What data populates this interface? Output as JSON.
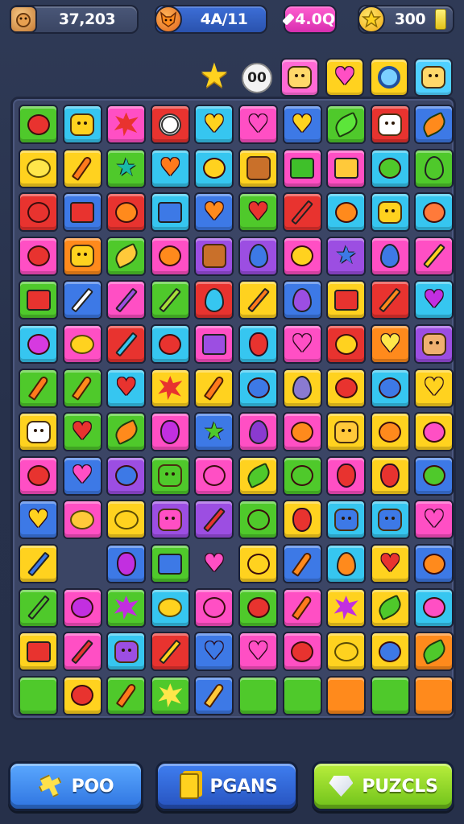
{
  "hud": {
    "coins": {
      "value": "37,203",
      "icon": "coin-icon"
    },
    "lives": {
      "value": "4A/11",
      "icon": "fox-icon"
    },
    "gems": {
      "value": "4.0Q",
      "icon": "gem-icon"
    },
    "stars": {
      "value": "300",
      "icon": "star-icon"
    }
  },
  "goals": {
    "star_icon": "★",
    "moves": "00",
    "targets": [
      {
        "icon": "face-icon",
        "color": "#ff6ad5"
      },
      {
        "icon": "heart-icon",
        "color": "#ffd21f"
      },
      {
        "icon": "ring-icon",
        "color": "#ffd21f"
      },
      {
        "icon": "face-icon",
        "color": "#4fd0ff"
      }
    ]
  },
  "board": {
    "cols": 10,
    "rows": 14,
    "tile_colors": {
      "R": "#e8332f",
      "O": "#ff8a1c",
      "Y": "#ffd21f",
      "G": "#4fc92b",
      "C": "#36c6f0",
      "B": "#3d79e6",
      "P": "#9c4ee2",
      "M": "#ff4fc4",
      "X": "#ffffff"
    },
    "grid": [
      [
        "G:apple:#e8332f",
        "C:face:#ffd21f",
        "M:splat:#e8332f",
        "R:ring:#ffffff",
        "C:heart:#ffd21f",
        "M:heart:#ff4fc4",
        "B:heart:#ffd21f",
        "G:leaf:#5ce53a",
        "R:face:#ffffff",
        "B:leaf:#ff8a1c"
      ],
      [
        "Y:lemon:#ffe64a",
        "Y:carrot:#ff7a1c",
        "G:star:#19b9a8",
        "C:heart:#ff7a1c",
        "C:apple:#ffd21f",
        "Y:waffle:#c9702a",
        "M:box:#3fc02a",
        "M:box:#ffc93a",
        "C:apple:#4fc92b",
        "G:drop:#4fc92b"
      ],
      [
        "R:apple:#e8332f",
        "B:box:#e8332f",
        "R:apple:#ff8a1c",
        "C:box:#3d79e6",
        "B:heart:#ff8a1c",
        "G:heart:#e8332f",
        "R:pencil:#e8332f",
        "C:apple:#ff8a1c",
        "C:face:#ffd21f",
        "C:apple:#ff7a3a"
      ],
      [
        "M:apple:#e8332f",
        "O:face:#ffd21f",
        "G:leaf:#ffc93a",
        "M:apple:#ff8a1c",
        "P:waffle:#c9702a",
        "P:drop:#3d79e6",
        "M:apple:#ffd21f",
        "P:star:#3d79e6",
        "M:drop:#3d79e6",
        "M:pencil:#ffd21f"
      ],
      [
        "G:box:#e8332f",
        "B:pencil:#ffffff",
        "M:pencil:#9c4ee2",
        "G:pencil:#a8e03a",
        "R:drop:#36c6f0",
        "Y:pencil:#ff7a1c",
        "B:drop:#9c4ee2",
        "Y:box:#e8332f",
        "R:pencil:#ff8a1c",
        "C:heart:#c22fe0"
      ],
      [
        "C:apple:#d63ae0",
        "M:lemon:#ffd21f",
        "R:pencil:#36c6f0",
        "C:apple:#e8332f",
        "M:box:#9c4ee2",
        "C:berry:#e8332f",
        "M:heart:#ff4fc4",
        "R:apple:#ffd21f",
        "O:heart:#ffe64a",
        "P:face:#f0b070"
      ],
      [
        "G:carrot:#ff7a1c",
        "G:carrot:#ff8a1c",
        "C:heart:#e8332f",
        "Y:splat:#e8332f",
        "Y:carrot:#ff7a1c",
        "C:apple:#3d79e6",
        "Y:drop:#8a7ad0",
        "Y:apple:#e8332f",
        "C:apple:#3d79e6",
        "Y:heart:#ffd21f"
      ],
      [
        "Y:face:#ffffff",
        "G:heart:#e8332f",
        "G:leaf:#ff8a1c",
        "M:berry:#c22fe0",
        "B:star:#4fc92b",
        "M:drop:#8a3ad0",
        "M:apple:#ff8a1c",
        "Y:face:#ffc93a",
        "Y:apple:#ff8a1c",
        "Y:apple:#ff4fc4"
      ],
      [
        "M:apple:#e8332f",
        "B:heart:#ff4fc4",
        "P:apple:#3d79e6",
        "G:face:#4fc92b",
        "M:apple:#ff4fc4",
        "Y:leaf:#4fc92b",
        "G:apple:#4fc92b",
        "M:berry:#e8332f",
        "Y:berry:#e8332f",
        "B:apple:#4fc92b"
      ],
      [
        "B:heart:#ffd21f",
        "M:lemon:#ffc93a",
        "Y:lemon:#ffd21f",
        "P:face:#ff4fc4",
        "P:pencil:#e8332f",
        "G:apple:#4fc92b",
        "Y:berry:#e8332f",
        "C:face:#3d79e6",
        "C:face:#3d79e6",
        "M:heart:#ff4fc4"
      ],
      [
        "Y:pencil:#3d79e6",
        "empty",
        "B:berry:#c22fe0",
        "G:box:#3d79e6",
        "empty-heart:#ff4fc4",
        "Y:apple:#ffd21f",
        "B:carrot:#ff8a1c",
        "C:drop:#ff8a1c",
        "Y:heart:#e8332f",
        "B:apple:#ff8a1c"
      ],
      [
        "G:pencil:#4fc92b",
        "M:apple:#c22fe0",
        "G:splat:#c22fe0",
        "C:lemon:#ffd21f",
        "M:apple:#ff4fc4",
        "G:apple:#e8332f",
        "M:carrot:#ff7a1c",
        "Y:splat:#c22fe0",
        "Y:leaf:#4fc92b",
        "C:apple:#ff4fc4"
      ],
      [
        "Y:box:#e8332f",
        "M:pencil:#e8332f",
        "C:face:#9c4ee2",
        "R:pencil:#ffd21f",
        "B:heart:#3d79e6",
        "M:heart:#ff4fc4",
        "M:apple:#e8332f",
        "Y:lemon:#ffd21f",
        "Y:apple:#3d79e6",
        "O:leaf:#4fc92b"
      ],
      [
        "G:none",
        "Y:apple:#e8332f",
        "G:carrot:#ff7a1c",
        "G:splat:#ffe64a",
        "B:carrot:#ffc93a",
        "G:none",
        "G:none",
        "O:none",
        "G:none",
        "O:none"
      ]
    ]
  },
  "buttons": {
    "play": {
      "label": "POO",
      "icon": "hammer-icon"
    },
    "pgans": {
      "label": "PGANS",
      "icon": "cards-icon"
    },
    "puzzles": {
      "label": "PUZCLS",
      "icon": "gem-icon"
    }
  }
}
